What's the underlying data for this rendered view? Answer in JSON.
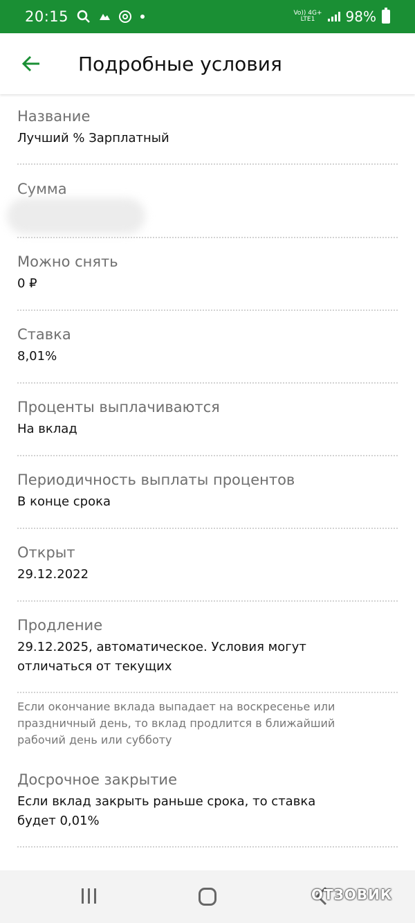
{
  "status_bar": {
    "time": "20:15",
    "network_top": "Vo)) 4G+",
    "network_bottom": "LTE1",
    "battery": "98%"
  },
  "header": {
    "title": "Подробные условия"
  },
  "details": [
    {
      "label": "Название",
      "value": "Лучший % Зарплатный"
    },
    {
      "label": "Сумма",
      "value": ""
    },
    {
      "label": "Можно снять",
      "value": "0 ₽"
    },
    {
      "label": "Ставка",
      "value": "8,01%"
    },
    {
      "label": "Проценты выплачиваются",
      "value": "На вклад"
    },
    {
      "label": "Периодичность выплаты процентов",
      "value": "В конце срока"
    },
    {
      "label": "Открыт",
      "value": "29.12.2022"
    },
    {
      "label": "Продление",
      "value_line1": "29.12.2025, автоматическое. Условия могут",
      "value_line2": "отличаться от текущих"
    },
    {
      "label": "Досрочное закрытие",
      "value_line1": "Если вклад закрыть раньше срока, то ставка",
      "value_line2": "будет 0,01%"
    }
  ],
  "renewal_note": {
    "line1": "Если окончание вклада выпадает на воскресенье или",
    "line2": "праздничный день, то вклад продлится в ближайший",
    "line3": "рабочий день или субботу"
  },
  "watermark": "ОТЗОВИК",
  "colors": {
    "status_bar": "#1a8f34",
    "accent": "#1a8f34"
  }
}
